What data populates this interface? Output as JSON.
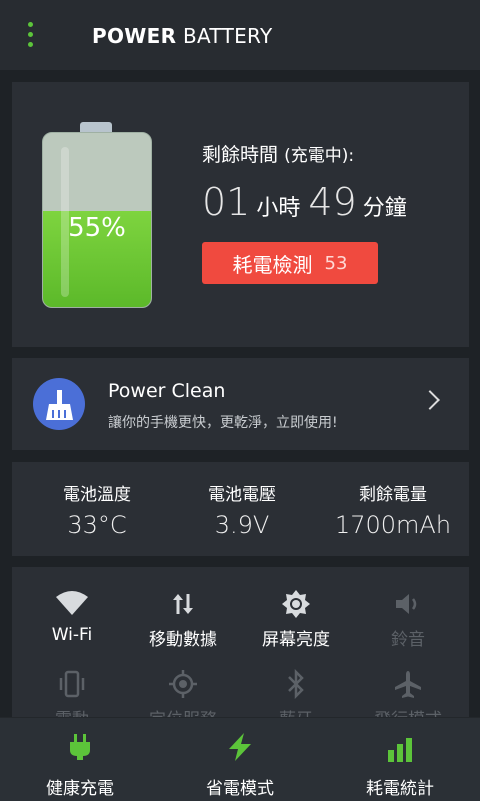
{
  "header": {
    "title_bold": "POWER",
    "title_rest": " BATTERY"
  },
  "battery": {
    "percent_text": "55%",
    "level": 0.55,
    "remaining_label": "剩餘時間",
    "remaining_note": "(充電中):",
    "hours": "01",
    "hours_unit": "小時",
    "minutes": "49",
    "minutes_unit": "分鐘",
    "detect_label": "耗電檢測",
    "detect_count": "53"
  },
  "clean": {
    "title": "Power Clean",
    "subtitle": "讓你的手機更快，更乾淨，立即使用!"
  },
  "stats": [
    {
      "label": "電池溫度",
      "value": "33°C"
    },
    {
      "label": "電池電壓",
      "value": "3.9V"
    },
    {
      "label": "剩餘電量",
      "value": "1700mAh"
    }
  ],
  "toggles": [
    {
      "label": "Wi-Fi",
      "icon": "wifi-icon",
      "on": true
    },
    {
      "label": "移動數據",
      "icon": "mobile-data-icon",
      "on": true
    },
    {
      "label": "屏幕亮度",
      "icon": "brightness-icon",
      "on": true
    },
    {
      "label": "鈴音",
      "icon": "volume-icon",
      "on": false
    },
    {
      "label": "震動",
      "icon": "vibrate-icon",
      "on": false
    },
    {
      "label": "定位服務",
      "icon": "location-icon",
      "on": false
    },
    {
      "label": "藍牙",
      "icon": "bluetooth-icon",
      "on": false
    },
    {
      "label": "飛行模式",
      "icon": "airplane-icon",
      "on": false
    }
  ],
  "bottom_nav": [
    {
      "label": "健康充電",
      "icon": "plug-icon"
    },
    {
      "label": "省電模式",
      "icon": "lightning-icon"
    },
    {
      "label": "耗電統計",
      "icon": "bar-chart-icon"
    }
  ],
  "colors": {
    "accent": "#5cc43a",
    "alert": "#f04a3f",
    "clean_icon": "#4b6fd7"
  }
}
